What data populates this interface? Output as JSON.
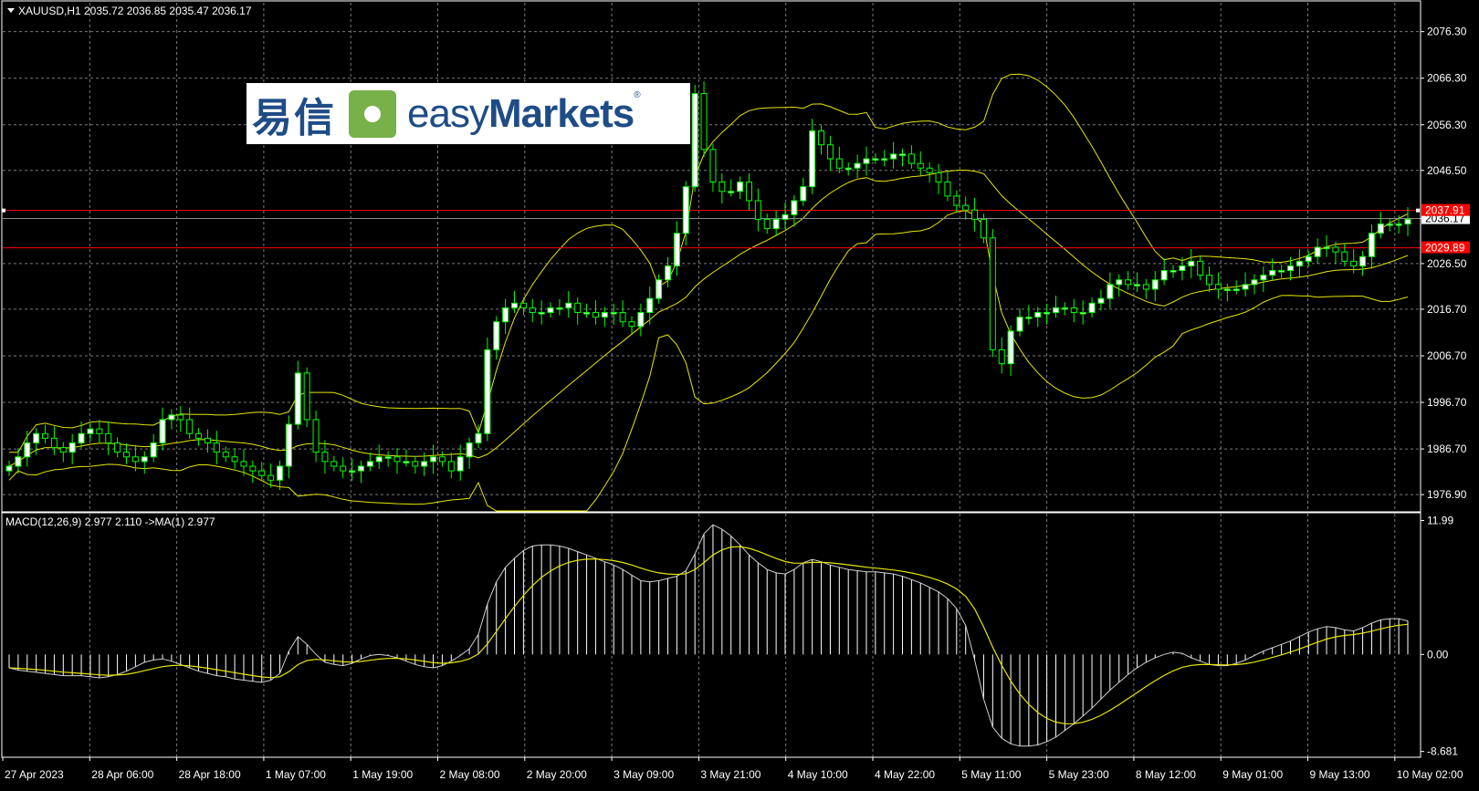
{
  "window": {
    "symbol_caption": "XAUUSD,H1",
    "ohlc": "2035.72 2036.85 2035.47 2036.17"
  },
  "logo": {
    "chinese": "易信",
    "english_light": "easy",
    "english_bold": "Markets",
    "registered": "®"
  },
  "price_axis": {
    "ticks": [
      "2076.30",
      "2066.30",
      "2056.30",
      "2046.50",
      "2036.17",
      "2026.50",
      "2016.70",
      "2006.70",
      "1996.70",
      "1986.70",
      "1976.90"
    ],
    "tick_values": [
      2076.3,
      2066.3,
      2056.3,
      2046.5,
      2036.17,
      2026.5,
      2016.7,
      2006.7,
      1996.7,
      1986.7,
      1976.9
    ],
    "range": [
      1973.4,
      2082.5
    ],
    "current_price": "2036.17",
    "hlines": [
      {
        "label": "2037.91",
        "value": 2037.91,
        "color": "#ff0000"
      },
      {
        "label": "2029.89",
        "value": 2029.89,
        "color": "#ff0000"
      }
    ]
  },
  "time_axis": {
    "labels": [
      "27 Apr 2023",
      "28 Apr 06:00",
      "28 Apr 18:00",
      "1 May 07:00",
      "1 May 19:00",
      "2 May 08:00",
      "2 May 20:00",
      "3 May 09:00",
      "3 May 21:00",
      "4 May 10:00",
      "4 May 22:00",
      "5 May 11:00",
      "5 May 23:00",
      "8 May 12:00",
      "9 May 01:00",
      "9 May 13:00",
      "10 May 02:00"
    ]
  },
  "macd": {
    "caption": "MACD(12,26,9) 2.977 2.110  ->MA(1) 2.977",
    "ticks": [
      "11.99",
      "0.00",
      "-8.681"
    ],
    "tick_values": [
      11.99,
      0,
      -8.681
    ],
    "range": [
      -9.2,
      12.6
    ]
  },
  "colors": {
    "background": "#000000",
    "grid": "#7a7a7a",
    "bull_candle": "#ffffff",
    "bear_candle": "#000000",
    "wick": "#00ff00",
    "bollinger": "#e6e600",
    "macd_hist": "#ffffff",
    "signal": "#e6e600",
    "hline": "#ff0000"
  },
  "chart_data": {
    "type": "candlestick",
    "title": "XAUUSD,H1",
    "price_series": [
      1983,
      1985,
      1988,
      1990,
      1989,
      1987,
      1986,
      1988,
      1990,
      1991,
      1990,
      1988,
      1986,
      1985,
      1984,
      1985,
      1988,
      1993,
      1994,
      1993,
      1990,
      1989,
      1988,
      1986,
      1985,
      1984,
      1983,
      1982,
      1981,
      1980,
      1983,
      1992,
      2003,
      1993,
      1986,
      1984,
      1983,
      1982,
      1982,
      1983,
      1984,
      1985,
      1985,
      1984,
      1984,
      1983,
      1984,
      1985,
      1984,
      1982,
      1985,
      1988,
      1990,
      2008,
      2014,
      2017,
      2018,
      2017,
      2016,
      2016,
      2017,
      2017,
      2018,
      2016,
      2016,
      2015,
      2016,
      2016,
      2014,
      2013,
      2016,
      2019,
      2023,
      2026,
      2033,
      2043,
      2063,
      2051,
      2044,
      2042,
      2042,
      2044,
      2040,
      2036,
      2034,
      2036,
      2037,
      2040,
      2043,
      2055,
      2052,
      2049,
      2047,
      2047,
      2048,
      2049,
      2049,
      2049,
      2050,
      2050,
      2048,
      2047,
      2046,
      2044,
      2041,
      2039,
      2038,
      2036,
      2032,
      2008,
      2005,
      2012,
      2015,
      2015,
      2016,
      2016,
      2017,
      2017,
      2016,
      2016,
      2018,
      2019,
      2022,
      2023,
      2022,
      2022,
      2021,
      2023,
      2025,
      2025,
      2026,
      2027,
      2024,
      2022,
      2021,
      2021,
      2021,
      2022,
      2023,
      2024,
      2025,
      2025,
      2026,
      2027,
      2028,
      2030,
      2030,
      2029,
      2027,
      2026,
      2028,
      2033,
      2035,
      2035,
      2035,
      2036
    ],
    "macd_series": [
      -1.2,
      -1.4,
      -1.5,
      -1.6,
      -1.7,
      -1.8,
      -1.9,
      -1.9,
      -1.9,
      -2.0,
      -2.1,
      -2.0,
      -1.8,
      -1.5,
      -1.1,
      -0.7,
      -0.5,
      -0.4,
      -0.6,
      -0.9,
      -1.2,
      -1.5,
      -1.7,
      -1.9,
      -2.0,
      -2.2,
      -2.3,
      -2.4,
      -2.5,
      -2.3,
      -1.7,
      0.3,
      1.6,
      0.9,
      0.0,
      -0.7,
      -0.9,
      -1.0,
      -0.8,
      -0.4,
      -0.1,
      0.0,
      -0.1,
      -0.3,
      -0.6,
      -0.9,
      -1.1,
      -1.2,
      -1.0,
      -0.6,
      -0.1,
      0.5,
      1.8,
      4.5,
      6.5,
      7.8,
      8.6,
      9.3,
      9.7,
      9.8,
      9.8,
      9.7,
      9.5,
      9.2,
      8.9,
      8.6,
      8.3,
      8.0,
      7.6,
      7.1,
      6.6,
      6.5,
      6.6,
      6.8,
      7.0,
      7.5,
      9.0,
      10.8,
      11.6,
      11.2,
      10.6,
      9.8,
      8.9,
      8.2,
      7.6,
      7.3,
      7.2,
      7.6,
      8.2,
      8.5,
      8.3,
      8.0,
      7.8,
      7.6,
      7.5,
      7.4,
      7.4,
      7.3,
      7.2,
      7.0,
      6.7,
      6.4,
      6.0,
      5.6,
      5.0,
      4.1,
      2.6,
      -0.5,
      -4.0,
      -6.5,
      -7.5,
      -8.0,
      -8.2,
      -8.2,
      -8.1,
      -7.8,
      -7.4,
      -6.8,
      -6.2,
      -5.5,
      -4.8,
      -4.0,
      -3.2,
      -2.5,
      -1.8,
      -1.2,
      -0.7,
      -0.3,
      0.0,
      0.2,
      0.1,
      -0.3,
      -0.6,
      -0.9,
      -1.0,
      -1.0,
      -0.8,
      -0.5,
      -0.1,
      0.3,
      0.6,
      0.9,
      1.2,
      1.6,
      2.0,
      2.3,
      2.5,
      2.4,
      2.2,
      2.1,
      2.4,
      2.8,
      3.1,
      3.2,
      3.2,
      3.0
    ],
    "ylabel": "",
    "xlabel": ""
  }
}
